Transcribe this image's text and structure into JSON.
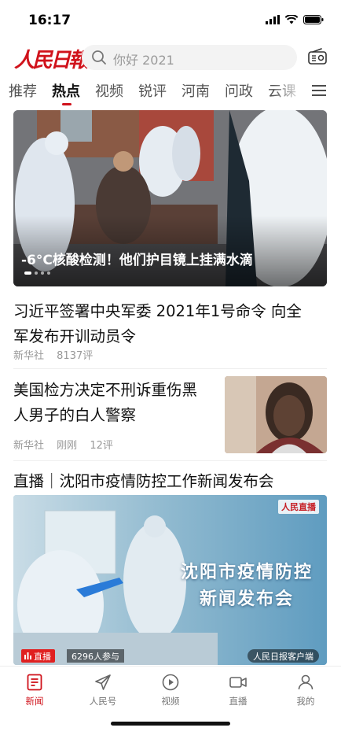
{
  "status_bar": {
    "time": "16:17"
  },
  "header": {
    "logo": "人民日報",
    "search_placeholder": "你好 2021",
    "search_icon": "search-icon",
    "radio_icon": "radio-icon"
  },
  "tabs": [
    {
      "label": "推荐",
      "active": false
    },
    {
      "label": "热点",
      "active": true
    },
    {
      "label": "视频",
      "active": false
    },
    {
      "label": "锐评",
      "active": false
    },
    {
      "label": "河南",
      "active": false
    },
    {
      "label": "问政",
      "active": false
    },
    {
      "label": "云课",
      "active": false
    }
  ],
  "hero": {
    "caption": "-6°C核酸检测！他们护目镜上挂满水滴",
    "slide_count": 4,
    "active_slide": 1
  },
  "news": [
    {
      "title_lines": [
        "习近平签署中央军委 2021年1号命令 向全",
        "军发布开训动员令"
      ],
      "source": "新华社",
      "comments": "8137评"
    },
    {
      "title_lines": [
        "美国检方决定不刑诉重伤黑",
        "人男子的白人警察"
      ],
      "source": "新华社",
      "time": "刚刚",
      "comments": "12评"
    }
  ],
  "live": {
    "title": "直播｜沈阳市疫情防控工作新闻发布会",
    "brand": "人民直播",
    "headline_lines": [
      "沈阳市疫情防控",
      "新闻发布会"
    ],
    "badge": "直播",
    "participants": "6296人参与",
    "source": "人民日报客户端"
  },
  "bottom_nav": [
    {
      "label": "新闻",
      "icon": "news-icon",
      "active": true
    },
    {
      "label": "人民号",
      "icon": "paper-plane-icon",
      "active": false
    },
    {
      "label": "视频",
      "icon": "play-icon",
      "active": false
    },
    {
      "label": "直播",
      "icon": "video-camera-icon",
      "active": false
    },
    {
      "label": "我的",
      "icon": "person-icon",
      "active": false
    }
  ],
  "colors": {
    "accent": "#d0121b",
    "live_red": "#e02020",
    "meta_gray": "#999999"
  }
}
